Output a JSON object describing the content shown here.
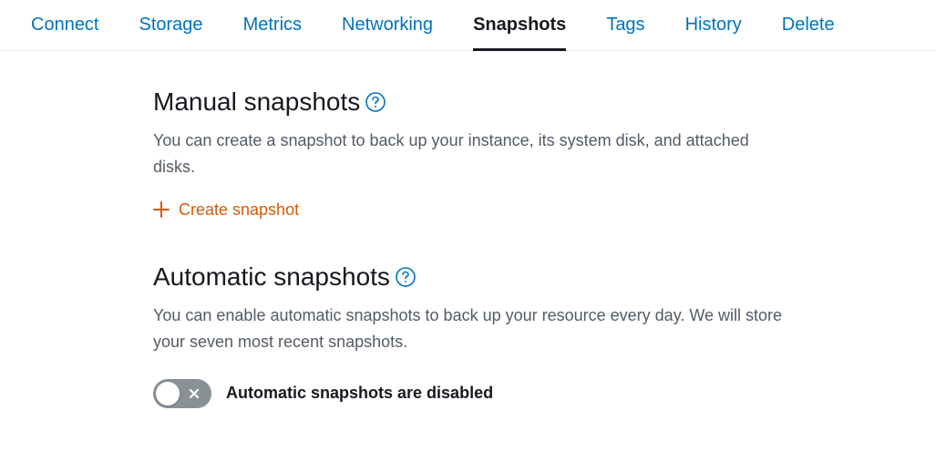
{
  "tabs": {
    "items": [
      {
        "label": "Connect"
      },
      {
        "label": "Storage"
      },
      {
        "label": "Metrics"
      },
      {
        "label": "Networking"
      },
      {
        "label": "Snapshots"
      },
      {
        "label": "Tags"
      },
      {
        "label": "History"
      },
      {
        "label": "Delete"
      }
    ],
    "active_index": 4
  },
  "manual": {
    "title": "Manual snapshots",
    "desc": "You can create a snapshot to back up your instance, its system disk, and attached disks.",
    "create_label": "Create snapshot"
  },
  "automatic": {
    "title": "Automatic snapshots",
    "desc": "You can enable automatic snapshots to back up your resource every day. We will store your seven most recent snapshots.",
    "toggle_label": "Automatic snapshots are disabled",
    "enabled": false
  }
}
